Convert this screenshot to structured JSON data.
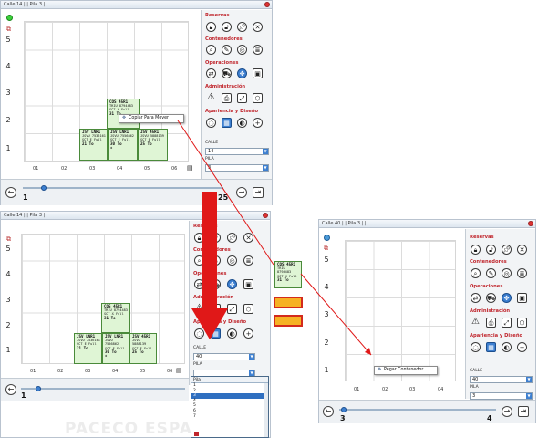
{
  "colors": {
    "accent": "#3d7fd0",
    "section_red": "#c0262d",
    "container_green": "#dff5d5",
    "arrow_red": "#e01818",
    "highlight_orange": "#f6b224"
  },
  "win1": {
    "title": "Calle 14 | | Pila 3 | |",
    "y_labels": [
      "5",
      "4",
      "3",
      "2",
      "1"
    ],
    "x_labels": [
      "01",
      "02",
      "03",
      "04",
      "05",
      "06"
    ],
    "containers": [
      {
        "lines": [
          "COS 45R1",
          "TRIU 8794483",
          "SCT  X  Full",
          "31 To"
        ]
      },
      {
        "lines": [
          "JSV LNR1",
          "JSVU 7536161",
          "SCT  E  Full",
          "21 To"
        ]
      },
      {
        "lines": [
          "JSV  LNR1",
          "JSVU 7556862",
          "SCT  E  Full",
          "30 To",
          "✻"
        ]
      },
      {
        "lines": [
          "JSV  45R1",
          "JSVU 5888139",
          "SCT  E  Full",
          "25 To"
        ]
      }
    ],
    "context_menu": "Copiar Para Mover",
    "sections": {
      "reservas": "Reservas",
      "contenedores": "Contenedores",
      "operaciones": "Operaciones",
      "administracion": "Administración",
      "apariencia": "Apariencia y Diseño"
    },
    "calle_label": "CALLE",
    "calle_value": "14",
    "pila_label": "PILA",
    "pila_value": "3",
    "slider_min": "1",
    "slider_max": "25",
    "slider_value": 1
  },
  "win2": {
    "title": "Calle 14 | | Pila 3 | |",
    "y_labels": [
      "5",
      "4",
      "3",
      "2",
      "1"
    ],
    "x_labels": [
      "01",
      "02",
      "03",
      "04",
      "05",
      "06"
    ],
    "containers": [
      {
        "lines": [
          "COS 45R1",
          "TRIU 8794483",
          "SCT  X  Full",
          "31 To"
        ]
      },
      {
        "lines": [
          "JSV LNR1",
          "JSVU 7536161",
          "SCT  E  Full",
          "21 To"
        ]
      },
      {
        "lines": [
          "JSV  LNR1",
          "JSVU 7556862",
          "SCT  E  Full",
          "30 To",
          "✻"
        ]
      },
      {
        "lines": [
          "JSV  45R1",
          "JSVU 5888139",
          "SCT  E  Full",
          "25 To"
        ]
      }
    ],
    "sections": {
      "reservas": "Reservas",
      "contenedores": "Contenedores",
      "operaciones": "Operaciones",
      "administracion": "Administración",
      "apariencia": "Apariencia y Diseño"
    },
    "calle_label": "CALLE",
    "calle_value": "40",
    "pila_label": "PILA",
    "pila_value": "",
    "dropdown_header": "Pila",
    "dropdown_items": [
      "1",
      "2",
      "3",
      "4",
      "5",
      "6",
      "7"
    ],
    "dropdown_selected": "3",
    "slider_min": "1",
    "slider_value": 1,
    "watermark": "PACECO ESPAÑA"
  },
  "win3": {
    "title": "Calle 40 | | Pila 3 | |",
    "y_labels": [
      "5",
      "4",
      "3",
      "2",
      "1"
    ],
    "x_labels": [
      "01",
      "02",
      "03",
      "04"
    ],
    "dragged_container": {
      "lines": [
        "COS 45R1",
        "TRIU 8794483",
        "SCT  X  Full",
        "31 To"
      ]
    },
    "context_menu": "Pegar Contenedor",
    "sections": {
      "reservas": "Reservas",
      "contenedores": "Contenedores",
      "operaciones": "Operaciones",
      "administracion": "Administración",
      "apariencia": "Apariencia y Diseño"
    },
    "calle_label": "CALLE",
    "calle_value": "40",
    "pila_label": "PILA",
    "pila_value": "3",
    "slider_min": "3",
    "slider_max": "4",
    "slider_value": 3
  },
  "icons": {
    "reservas": [
      "lock-icon",
      "unlock-icon",
      "pin-icon",
      "unpin-icon"
    ],
    "contenedores": [
      "search-icon",
      "edit-icon",
      "target-icon",
      "list-icon"
    ],
    "operaciones": [
      "swap-icon",
      "truck-icon",
      "move-icon",
      "save-icon"
    ],
    "administracion": [
      "warning-icon",
      "print-icon",
      "expand-icon",
      "cube-icon"
    ],
    "apariencia": [
      "chat-icon",
      "grid-view-icon",
      "color-icon",
      "add-icon"
    ]
  }
}
